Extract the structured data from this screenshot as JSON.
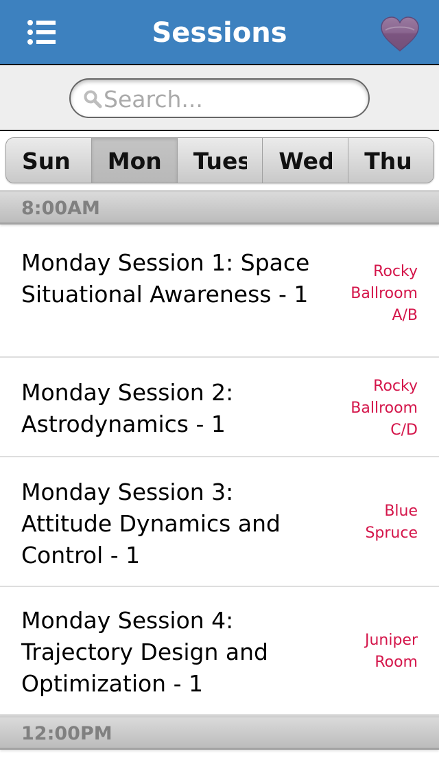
{
  "header": {
    "title": "Sessions",
    "menu_icon": "list-menu-icon",
    "favorites_icon": "heart-icon"
  },
  "search": {
    "placeholder": "Search...",
    "value": "",
    "icon": "search-icon"
  },
  "day_tabs": [
    {
      "label": "Sun",
      "active": false
    },
    {
      "label": "Mon",
      "active": true
    },
    {
      "label": "Tues",
      "active": false
    },
    {
      "label": "Wed",
      "active": false
    },
    {
      "label": "Thu",
      "active": false
    }
  ],
  "sections": [
    {
      "time": "8:00AM",
      "sessions": [
        {
          "title": "Monday Session 1: Space Situational Awareness - 1",
          "room": "Rocky Ballroom A/B"
        },
        {
          "title": "Monday Session 2: Astrodynamics - 1",
          "room": "Rocky Ballroom C/D"
        },
        {
          "title": "Monday Session 3: Attitude Dynamics and Control - 1",
          "room": "Blue Spruce"
        },
        {
          "title": "Monday Session 4: Trajectory Design and Optimization - 1",
          "room": "Juniper Room"
        }
      ]
    },
    {
      "time": "12:00PM",
      "sessions": []
    }
  ],
  "colors": {
    "nav_background": "#3d81bf",
    "room_text": "#d4154a",
    "section_header_text": "#808080",
    "heart": "#7f5a82"
  }
}
